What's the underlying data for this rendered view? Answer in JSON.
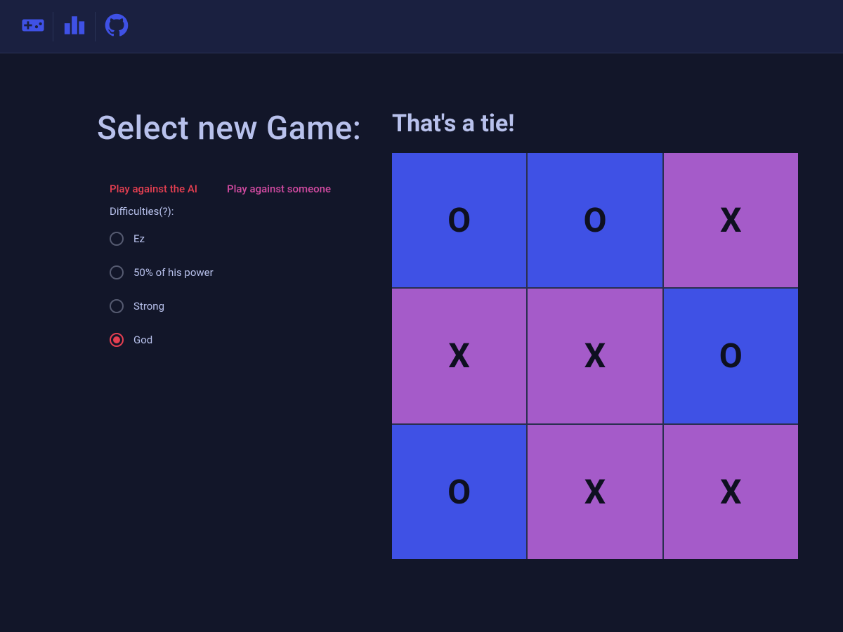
{
  "nav": {
    "icons": [
      "game-icon",
      "leaderboard-icon",
      "github-icon"
    ]
  },
  "left": {
    "title": "Select new Game:",
    "link_ai": "Play against the AI",
    "link_pvp": "Play against someone",
    "diff_label": "Difficulties(?):",
    "difficulties": [
      {
        "label": "Ez",
        "selected": false
      },
      {
        "label": "50% of his power",
        "selected": false
      },
      {
        "label": "Strong",
        "selected": false
      },
      {
        "label": "God",
        "selected": true
      }
    ]
  },
  "game": {
    "status": "That's a tie!",
    "board": [
      "O",
      "O",
      "X",
      "X",
      "X",
      "O",
      "O",
      "X",
      "X"
    ]
  },
  "colors": {
    "blue": "#3f51e5",
    "purple": "#a55bc9",
    "bg": "#121629"
  }
}
